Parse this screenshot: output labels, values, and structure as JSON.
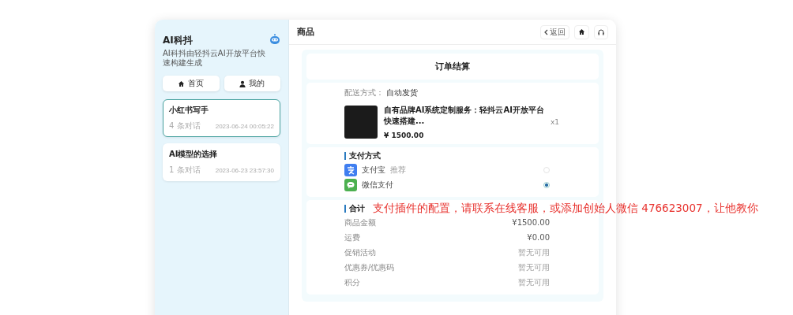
{
  "sidebar": {
    "title": "AI科抖",
    "subtitle": "AI科抖由轻抖云AI开放平台快速构建生成",
    "nav_buttons": [
      {
        "kind": "home",
        "label": "首页"
      },
      {
        "kind": "user",
        "label": "我的"
      }
    ],
    "chats": [
      {
        "title": "小红书写手",
        "count": "4 条对话",
        "time": "2023-06-24 00:05:22",
        "selected": true
      },
      {
        "title": "AI模型的选择",
        "count": "1 条对话",
        "time": "2023-06-23 23:57:30",
        "selected": false
      }
    ]
  },
  "header": {
    "title": "商品",
    "back_label": "返回"
  },
  "order": {
    "title": "订单结算",
    "delivery": {
      "label": "配送方式：",
      "value": "自动发货"
    },
    "product": {
      "name": "自有品牌AI系统定制服务：轻抖云AI开放平台快速搭建...",
      "price": "¥ 1500.00",
      "quantity": "x1"
    },
    "payment": {
      "title": "支付方式",
      "methods": [
        {
          "kind": "alipay",
          "name": "支付宝",
          "tag": "推荐",
          "selected": false
        },
        {
          "kind": "wechat",
          "name": "微信支付",
          "selected": true
        }
      ]
    },
    "summary": {
      "title": "合计",
      "rows": [
        {
          "label": "商品金额",
          "value": "¥1500.00"
        },
        {
          "label": "运费",
          "value": "¥0.00"
        },
        {
          "label": "促销活动",
          "value": "暂无可用"
        },
        {
          "label": "优惠券/优惠码",
          "value": "暂无可用"
        },
        {
          "label": "积分",
          "value": "暂无可用"
        }
      ]
    }
  },
  "annotation": "支付插件的配置，请联系在线客服，或添加创始人微信 476623007，让他教你"
}
